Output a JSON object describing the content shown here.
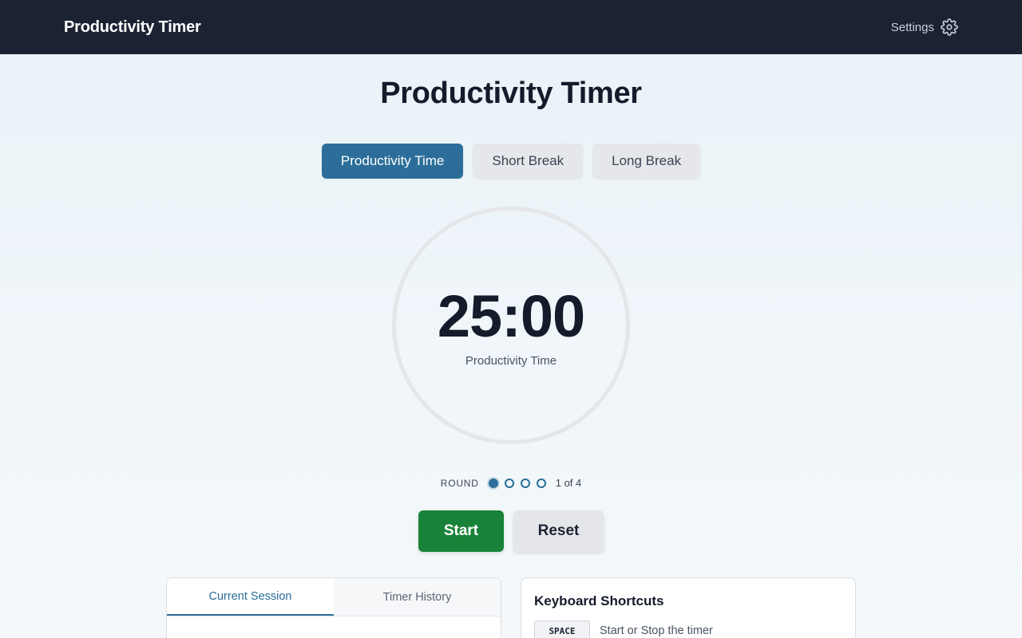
{
  "header": {
    "brand": "Productivity Timer",
    "settings_label": "Settings",
    "settings_icon": "gear-icon"
  },
  "page": {
    "title": "Productivity Timer"
  },
  "modes": {
    "items": [
      {
        "label": "Productivity Time",
        "active": true
      },
      {
        "label": "Short Break",
        "active": false
      },
      {
        "label": "Long Break",
        "active": false
      }
    ]
  },
  "timer": {
    "time": "25:00",
    "label": "Productivity Time"
  },
  "round": {
    "label": "ROUND",
    "current": 1,
    "total": 4,
    "count_text": "1 of 4"
  },
  "controls": {
    "start_label": "Start",
    "reset_label": "Reset"
  },
  "session_panel": {
    "tabs": [
      {
        "label": "Current Session",
        "active": true
      },
      {
        "label": "Timer History",
        "active": false
      }
    ]
  },
  "shortcuts_panel": {
    "title": "Keyboard Shortcuts",
    "items": [
      {
        "key": "SPACE",
        "description": "Start or Stop the timer"
      }
    ]
  },
  "colors": {
    "header_bg": "#1b2333",
    "accent": "#2c6e99",
    "start_green": "#188338"
  }
}
